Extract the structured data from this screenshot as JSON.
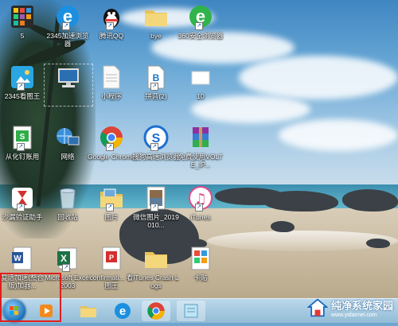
{
  "desktop": {
    "icons": [
      {
        "label": "5",
        "icon": "phone-app-icon"
      },
      {
        "label": "2345加速浏览器",
        "icon": "browser-e-icon"
      },
      {
        "label": "腾讯QQ",
        "icon": "qq-penguin-icon"
      },
      {
        "label": "bye",
        "icon": "folder-icon"
      },
      {
        "label": "360安全浏览器",
        "icon": "360-browser-icon"
      },
      {
        "label": "2345看图王",
        "icon": "image-viewer-icon"
      },
      {
        "label": "",
        "icon": "computer-icon"
      },
      {
        "label": "小程序",
        "icon": "blank-file-icon"
      },
      {
        "label": "拼音(2)",
        "icon": "text-file-icon"
      },
      {
        "label": "10",
        "icon": "white-file-icon"
      },
      {
        "label": "从化钉账用",
        "icon": "green-doc-icon"
      },
      {
        "label": "网络",
        "icon": "network-icon"
      },
      {
        "label": "Google Chrome",
        "icon": "chrome-icon"
      },
      {
        "label": "搜狗高速浏览器",
        "icon": "sogou-browser-icon"
      },
      {
        "label": "免费使用VOLTE_IP...",
        "icon": "winrar-icon"
      },
      {
        "label": "沙漏验证助手",
        "icon": "hourglass-icon"
      },
      {
        "label": "回收站",
        "icon": "recycle-bin-icon"
      },
      {
        "label": "图片",
        "icon": "pictures-folder-icon"
      },
      {
        "label": "微信图片_2019010...",
        "icon": "photo-file-icon"
      },
      {
        "label": "iTunes",
        "icon": "itunes-icon"
      },
      {
        "label": "复活加速(整合版)加器...",
        "icon": "word-doc-icon"
      },
      {
        "label": "Microsoft Excel 2003",
        "icon": "excel-icon"
      },
      {
        "label": "confirmati... 看图王",
        "icon": "pdf-icon"
      },
      {
        "label": "iTunes Crash Logs",
        "icon": "folder-icon"
      },
      {
        "label": "卡贴",
        "icon": "grid-file-icon"
      }
    ]
  },
  "taskbar": {
    "items": [
      {
        "name": "start-button",
        "icon": "windows-logo-icon"
      },
      {
        "name": "media-player",
        "icon": "play-icon"
      },
      {
        "name": "file-explorer",
        "icon": "folder-icon"
      },
      {
        "name": "internet-explorer",
        "icon": "ie-icon"
      },
      {
        "name": "google-chrome",
        "icon": "chrome-icon"
      },
      {
        "name": "notepad",
        "icon": "notepad-icon"
      }
    ]
  },
  "watermark": {
    "brand": "纯净系统家园",
    "url": "www.yidaimei.com"
  },
  "colors": {
    "highlight_box": "#e01e1e",
    "taskbar": "#a9cbe0"
  }
}
